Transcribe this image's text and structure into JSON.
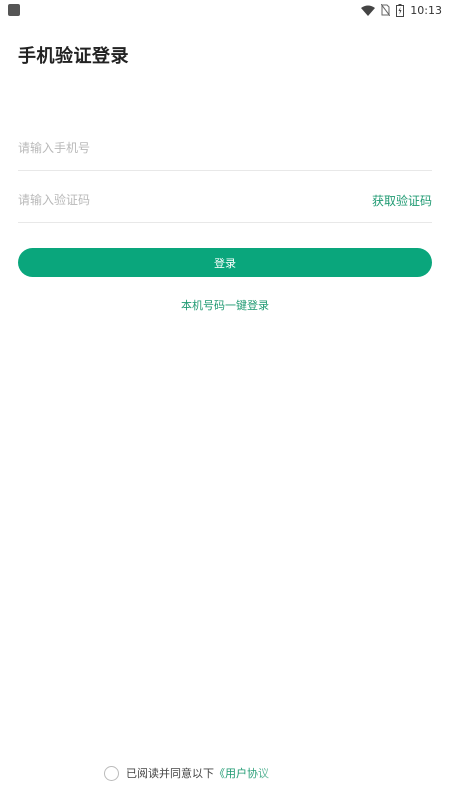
{
  "status_bar": {
    "time": "10:13",
    "icons": [
      "app-square-icon",
      "wifi-icon",
      "no-sim-icon",
      "battery-icon"
    ]
  },
  "page": {
    "title": "手机验证登录"
  },
  "form": {
    "phone_placeholder": "请输入手机号",
    "phone_value": "",
    "code_placeholder": "请输入验证码",
    "code_value": "",
    "get_code_label": "获取验证码",
    "login_label": "登录",
    "one_click_label": "本机号码一键登录"
  },
  "agreement": {
    "text": "已阅读并同意以下",
    "link": "《用户协议"
  },
  "colors": {
    "accent": "#0aa67c",
    "link": "#1f9a72",
    "placeholder": "#b9b9b9",
    "divider": "#e8e8e8"
  }
}
